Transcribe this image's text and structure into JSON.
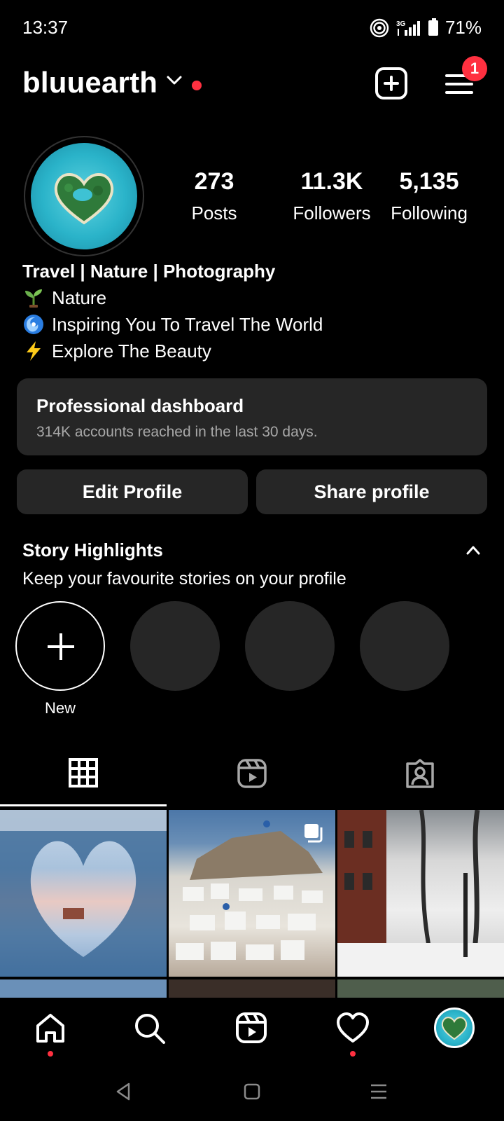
{
  "status_bar": {
    "time": "13:37",
    "network": "3G",
    "battery": "71%"
  },
  "header": {
    "username": "bluuearth",
    "menu_badge": "1"
  },
  "stats": [
    {
      "value": "273",
      "label": "Posts"
    },
    {
      "value": "11.3K",
      "label": "Followers"
    },
    {
      "value": "5,135",
      "label": "Following"
    }
  ],
  "bio": {
    "title": "Travel | Nature | Photography",
    "lines": [
      {
        "icon": "seedling-icon",
        "text": "Nature"
      },
      {
        "icon": "cyclone-icon",
        "text": "Inspiring You To Travel The World"
      },
      {
        "icon": "lightning-icon",
        "text": "Explore The Beauty"
      }
    ]
  },
  "dashboard": {
    "title": "Professional dashboard",
    "subtitle": "314K accounts reached in the last 30 days."
  },
  "actions": {
    "edit": "Edit Profile",
    "share": "Share profile"
  },
  "highlights": {
    "title": "Story Highlights",
    "subtitle": "Keep your favourite stories on your profile",
    "new_label": "New"
  },
  "tabs": [
    "grid-icon",
    "reels-icon",
    "tagged-icon"
  ],
  "colors": {
    "background": "#000000",
    "surface": "#262626",
    "accent_red": "#ff3040",
    "muted_text": "#a8a8a8"
  }
}
